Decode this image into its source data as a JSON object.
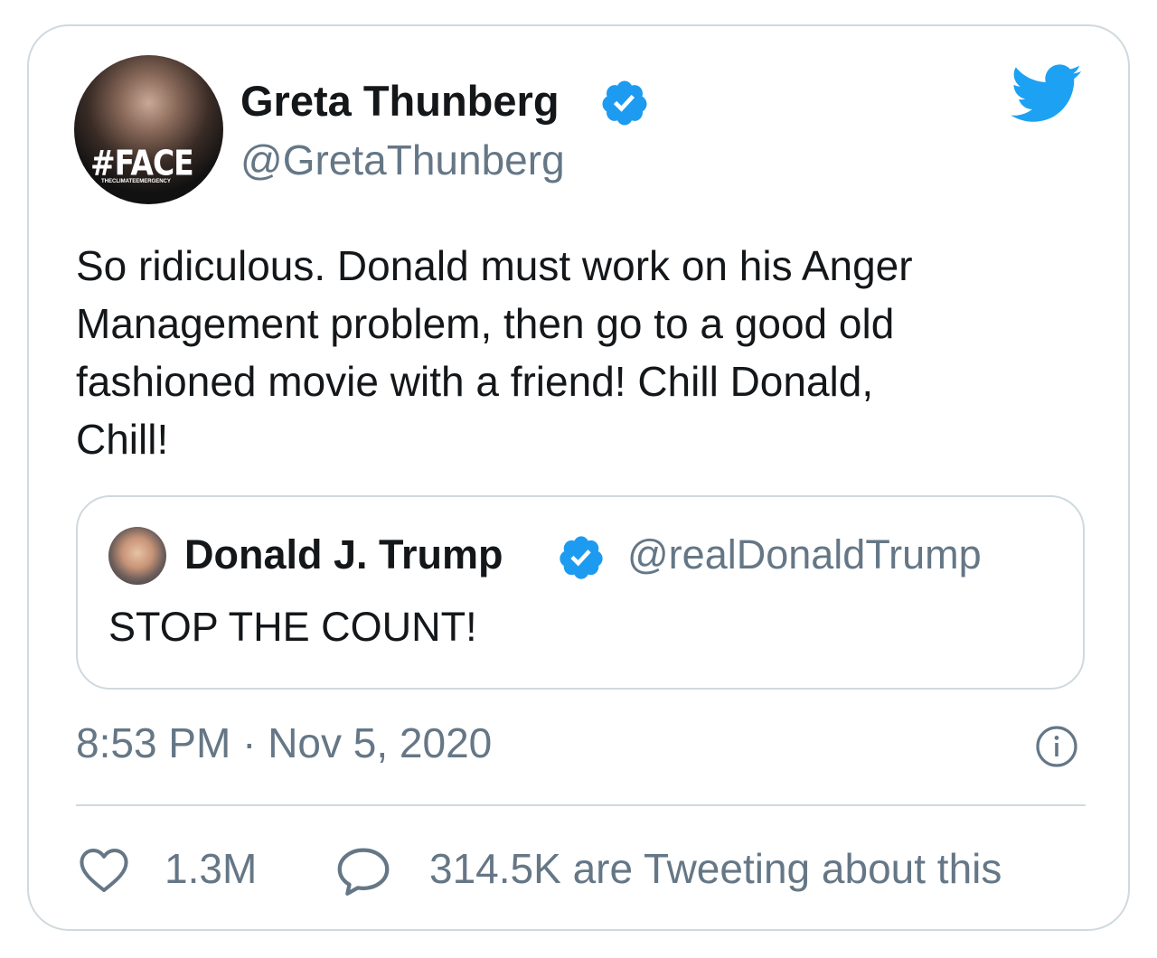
{
  "tweet": {
    "author": {
      "display_name": "Greta Thunberg",
      "handle": "@GretaThunberg",
      "verified": true,
      "avatar_text": "#FACE",
      "avatar_subtext": "THECLIMATEEMERGENCY"
    },
    "text_lines": [
      "So ridiculous. Donald must work on his Anger",
      "Management problem, then go to a good old",
      "fashioned movie with a friend! Chill Donald,",
      "Chill!"
    ],
    "quoted": {
      "display_name": "Donald J. Trump",
      "handle": "@realDonaldTrump",
      "verified": true,
      "text": "STOP THE COUNT!"
    },
    "timestamp": "8:53 PM · Nov 5, 2020",
    "likes": "1.3M",
    "tweeting_about": "314.5K are Tweeting about this"
  },
  "icons": {
    "brand": "twitter-bird-icon",
    "verified": "verified-badge-icon",
    "info": "info-icon",
    "like": "heart-icon",
    "reply": "speech-bubble-icon"
  },
  "colors": {
    "twitter_blue": "#1da1f2",
    "verified_blue": "#1d9bf0",
    "text_primary": "#14171a",
    "text_secondary": "#657786",
    "border": "#cfd9de"
  }
}
